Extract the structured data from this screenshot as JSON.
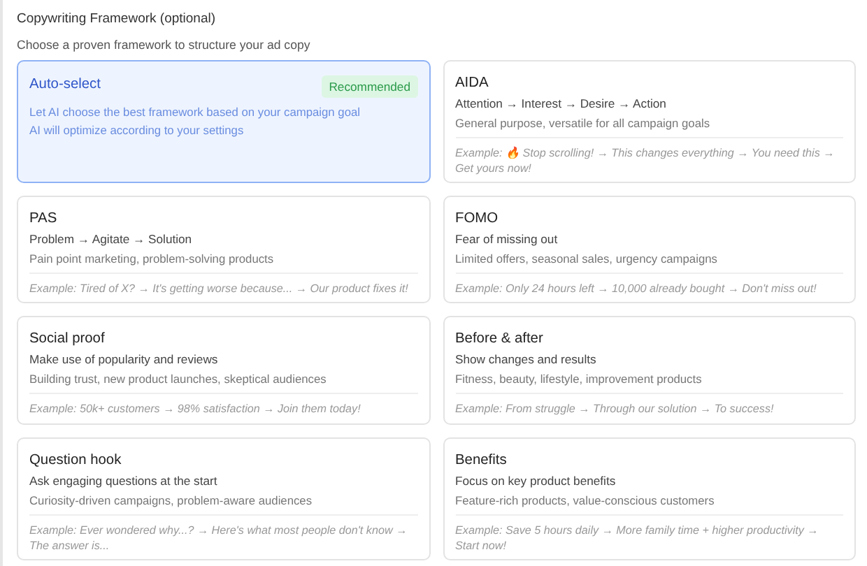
{
  "heading": "Copywriting Framework (optional)",
  "subheading": "Choose a proven framework to structure your ad copy",
  "frameworks": [
    {
      "kind": "auto",
      "title": "Auto-select",
      "badge": "Recommended",
      "lines": [
        "Let AI choose the best framework based on your campaign goal",
        "AI will optimize according to your settings"
      ],
      "selected": true
    },
    {
      "kind": "framework",
      "title": "AIDA",
      "steps": "Attention → Interest → Desire → Action",
      "use": "General purpose, versatile for all campaign goals",
      "example": "Example: 🔥 Stop scrolling! → This changes everything → You need this → Get yours now!",
      "selected": false
    },
    {
      "kind": "framework",
      "title": "PAS",
      "steps": "Problem → Agitate → Solution",
      "use": "Pain point marketing, problem-solving products",
      "example": "Example: Tired of X? → It's getting worse because... → Our product fixes it!",
      "selected": false
    },
    {
      "kind": "framework",
      "title": "FOMO",
      "steps": "Fear of missing out",
      "use": "Limited offers, seasonal sales, urgency campaigns",
      "example": "Example: Only 24 hours left → 10,000 already bought → Don't miss out!",
      "selected": false
    },
    {
      "kind": "framework",
      "title": "Social proof",
      "steps": "Make use of popularity and reviews",
      "use": "Building trust, new product launches, skeptical audiences",
      "example": "Example: 50k+ customers → 98% satisfaction → Join them today!",
      "selected": false
    },
    {
      "kind": "framework",
      "title": "Before & after",
      "steps": "Show changes and results",
      "use": "Fitness, beauty, lifestyle, improvement products",
      "example": "Example: From struggle → Through our solution → To success!",
      "selected": false
    },
    {
      "kind": "framework",
      "title": "Question hook",
      "steps": "Ask engaging questions at the start",
      "use": "Curiosity-driven campaigns, problem-aware audiences",
      "example": "Example: Ever wondered why...? → Here's what most people don't know → The answer is...",
      "selected": false
    },
    {
      "kind": "framework",
      "title": "Benefits",
      "steps": "Focus on key product benefits",
      "use": "Feature-rich products, value-conscious customers",
      "example": "Example: Save 5 hours daily → More family time + higher productivity → Start now!",
      "selected": false
    }
  ]
}
